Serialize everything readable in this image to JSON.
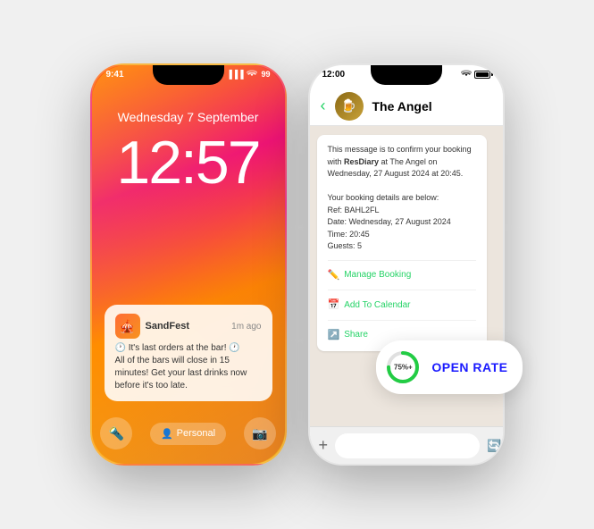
{
  "left_phone": {
    "status_bar": {
      "time": "9:41",
      "signal": "▐▐▐",
      "wifi": "wifi",
      "battery": "99"
    },
    "date": "Wednesday 7 September",
    "time": "12:57",
    "notification": {
      "app_name": "SandFest",
      "time_ago": "1m ago",
      "icon": "🎪",
      "line1": "🕐 It's last orders at the bar! 🕐",
      "line2": "All of the bars will close in 15 minutes! Get your last drinks now before it's too late."
    },
    "bottom_bar": {
      "left_icon": "🔦",
      "center_label": "Personal",
      "right_icon": "📷"
    }
  },
  "right_phone": {
    "status_bar": {
      "time": "12:00",
      "wifi": "wifi",
      "battery_pct": 90
    },
    "header": {
      "contact": "The Angel",
      "back_label": "‹"
    },
    "message": {
      "body": "This message is to confirm your booking with ResDiary at The Angel on Wednesday, 27 August 2024 at 20:45.\n\nYour booking details are below:\nRef: BAHL2FL\nDate: Wednesday, 27 August 2024\nTime: 20:45\nGuests: 5",
      "action1": "Manage Booking",
      "action2": "Add To Calendar",
      "action3": "Share"
    },
    "input_bar": {
      "placeholder": ""
    }
  },
  "open_rate_badge": {
    "value": "75%+",
    "label": "OPEN RATE",
    "chart_percent": 75
  }
}
